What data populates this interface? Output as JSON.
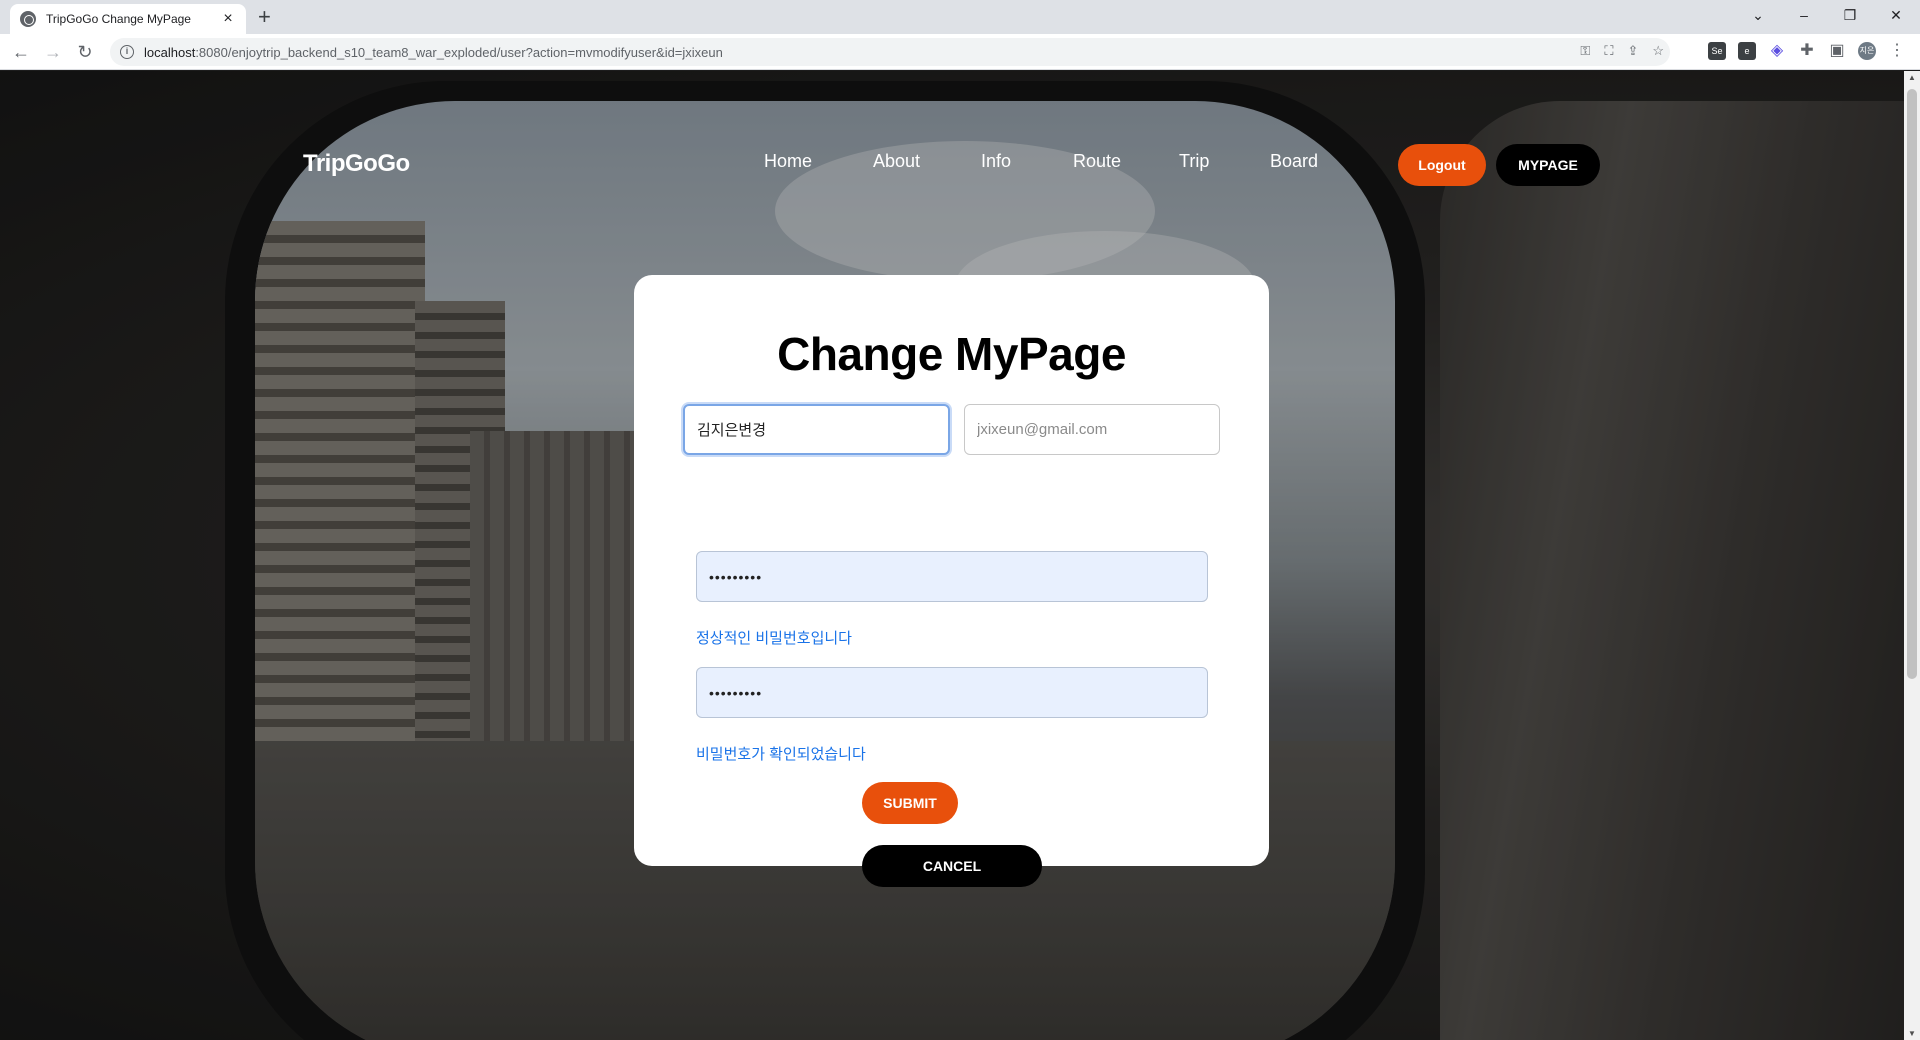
{
  "browser": {
    "tab_title": "TripGoGo Change MyPage",
    "url_host": "localhost",
    "url_path": ":8080/enjoytrip_backend_s10_team8_war_exploded/user?action=mvmodifyuser&id=jxixeun",
    "profile_initials": "지은"
  },
  "header": {
    "logo": "TripGoGo",
    "nav": [
      {
        "label": "Home"
      },
      {
        "label": "About"
      },
      {
        "label": "Info"
      },
      {
        "label": "Route"
      },
      {
        "label": "Trip"
      },
      {
        "label": "Board"
      }
    ],
    "logout_label": "Logout",
    "mypage_label": "MYPAGE"
  },
  "form": {
    "title": "Change MyPage",
    "name_value": "김지은변경",
    "email_placeholder": "jxixeun@gmail.com",
    "password_value": "•••••••••",
    "password_confirm_value": "•••••••••",
    "password_message": "정상적인 비밀번호입니다",
    "confirm_message": "비밀번호가 확인되었습니다",
    "submit_label": "SUBMIT",
    "cancel_label": "CANCEL"
  },
  "colors": {
    "accent": "#e8500c",
    "message": "#1a73e8"
  }
}
